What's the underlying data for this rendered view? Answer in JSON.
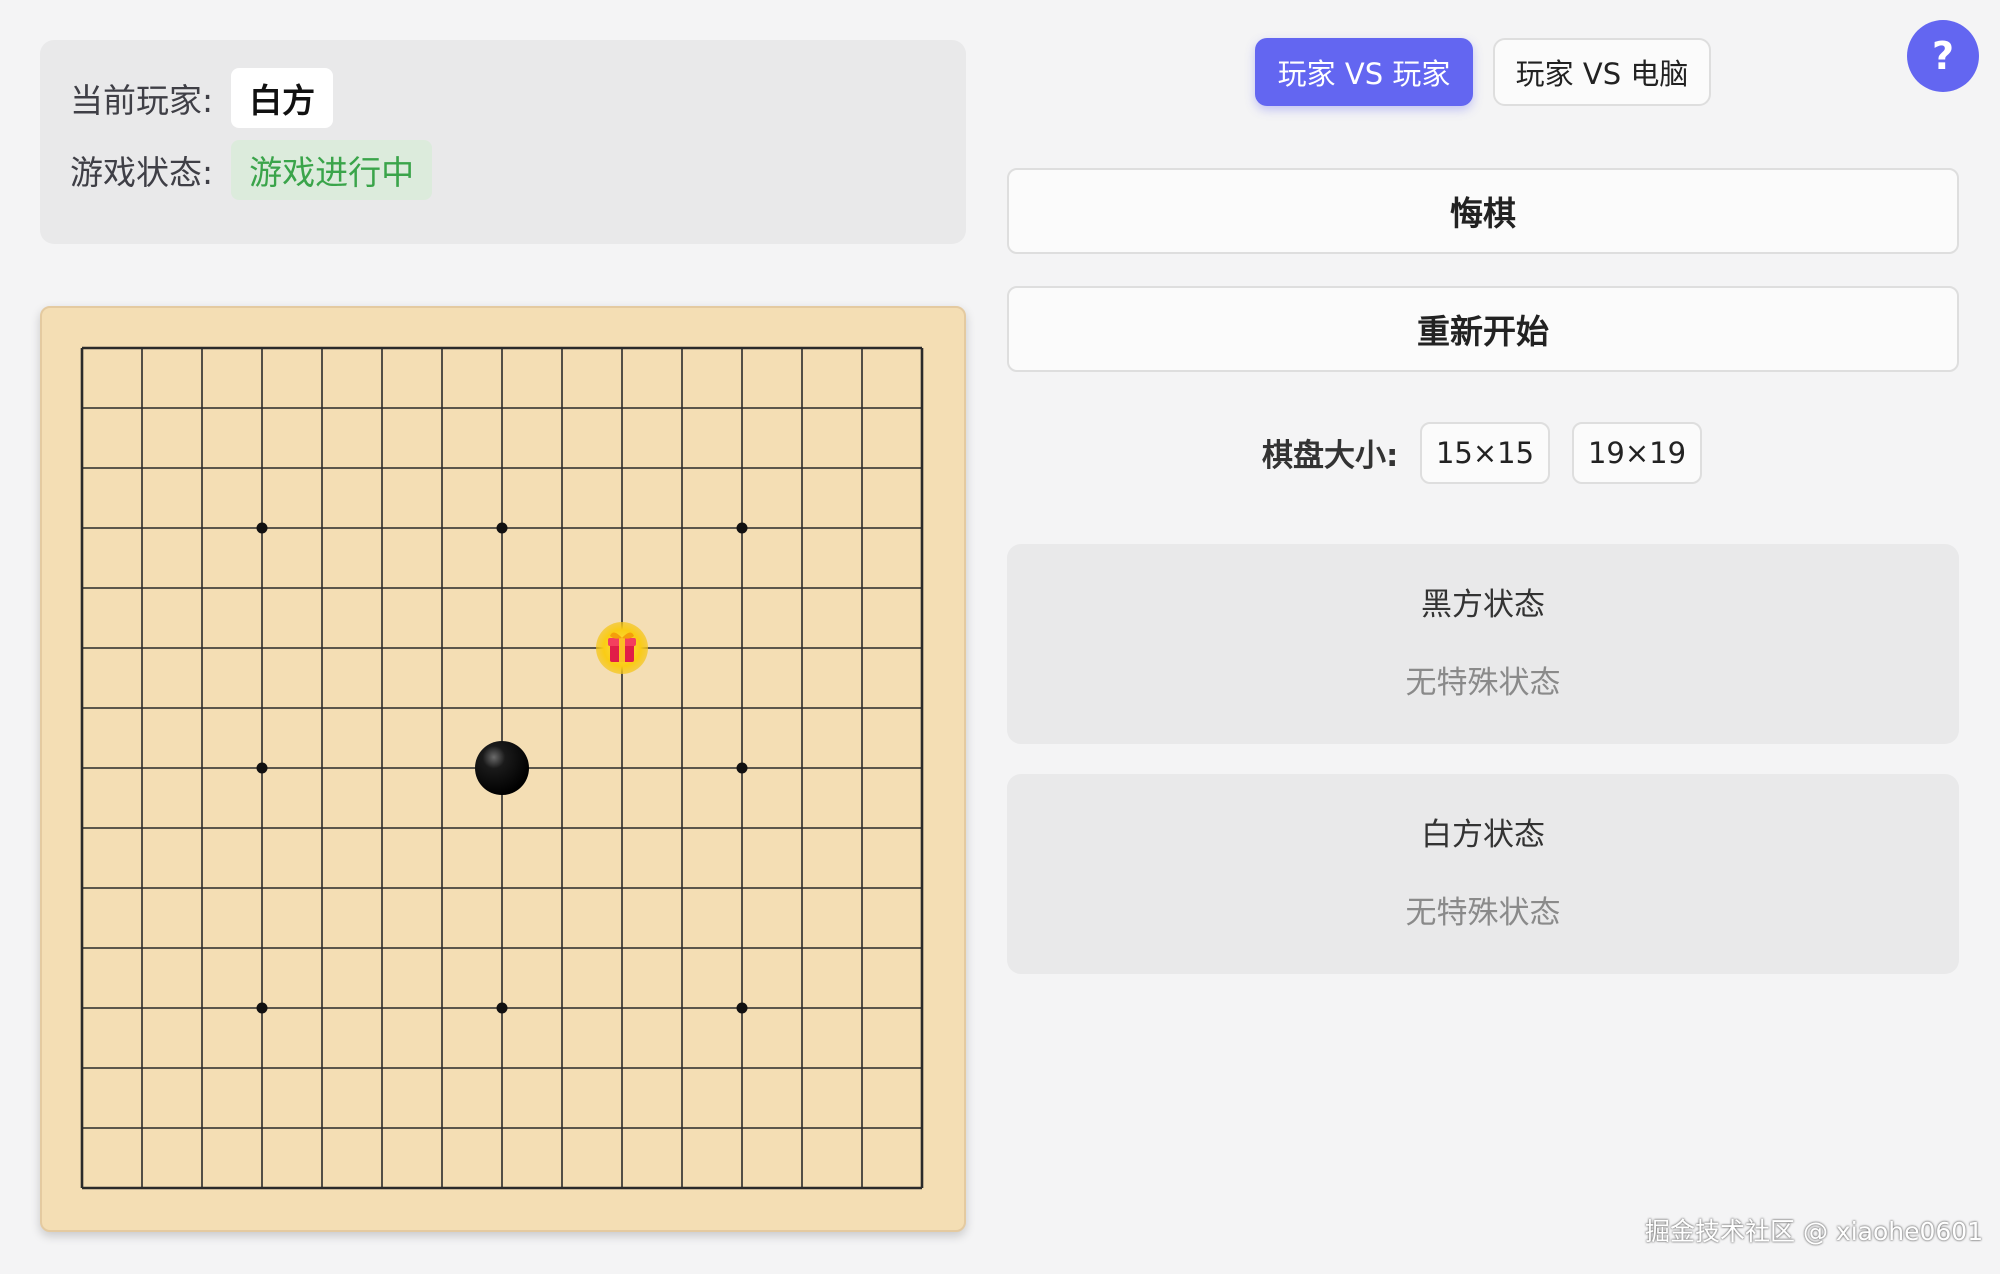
{
  "info": {
    "current_player_label": "当前玩家:",
    "current_player_value": "白方",
    "game_status_label": "游戏状态:",
    "game_status_value": "游戏进行中"
  },
  "mode_buttons": {
    "pvp": "玩家 VS 玩家",
    "pvc": "玩家 VS 电脑",
    "active": "pvp"
  },
  "help_button": "?",
  "actions": {
    "undo": "悔棋",
    "restart": "重新开始"
  },
  "board_size": {
    "label": "棋盘大小:",
    "options": [
      "15×15",
      "19×19"
    ]
  },
  "black_status": {
    "title": "黑方状态",
    "text": "无特殊状态"
  },
  "white_status": {
    "title": "白方状态",
    "text": "无特殊状态"
  },
  "board": {
    "size": 15,
    "star_points": [
      [
        3,
        3
      ],
      [
        3,
        7
      ],
      [
        3,
        11
      ],
      [
        7,
        3
      ],
      [
        7,
        11
      ],
      [
        11,
        3
      ],
      [
        11,
        7
      ],
      [
        11,
        11
      ]
    ],
    "stones": [
      {
        "color": "black",
        "row": 7,
        "col": 7
      }
    ],
    "items": [
      {
        "type": "gift-icon",
        "row": 5,
        "col": 9
      }
    ]
  },
  "colors": {
    "accent": "#6366f1",
    "status_green": "#3aa44a",
    "board_wood": "#f4deb4"
  },
  "watermark": "掘金技术社区 @ xiaohe0601"
}
